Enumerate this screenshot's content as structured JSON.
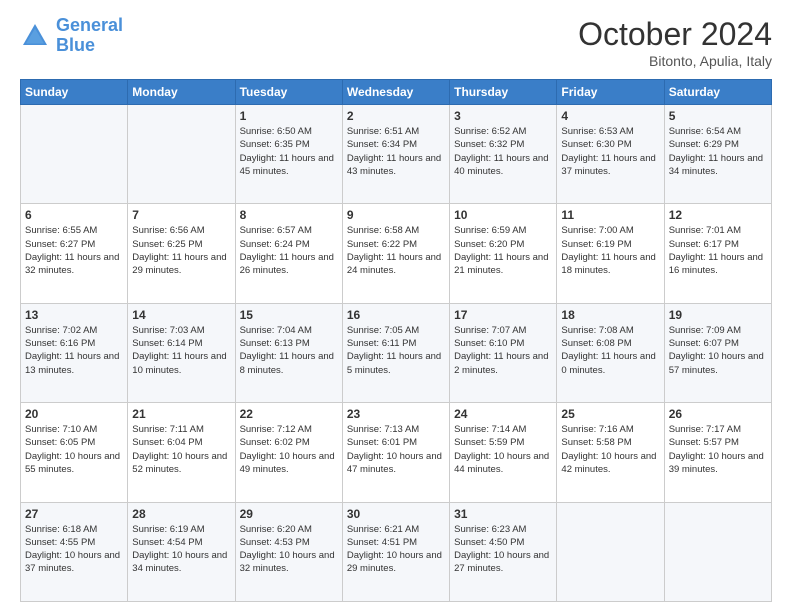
{
  "header": {
    "logo_line1": "General",
    "logo_line2": "Blue",
    "month_title": "October 2024",
    "subtitle": "Bitonto, Apulia, Italy"
  },
  "days_of_week": [
    "Sunday",
    "Monday",
    "Tuesday",
    "Wednesday",
    "Thursday",
    "Friday",
    "Saturday"
  ],
  "weeks": [
    [
      {
        "day": "",
        "info": ""
      },
      {
        "day": "",
        "info": ""
      },
      {
        "day": "1",
        "sunrise": "6:50 AM",
        "sunset": "6:35 PM",
        "daylight": "11 hours and 45 minutes."
      },
      {
        "day": "2",
        "sunrise": "6:51 AM",
        "sunset": "6:34 PM",
        "daylight": "11 hours and 43 minutes."
      },
      {
        "day": "3",
        "sunrise": "6:52 AM",
        "sunset": "6:32 PM",
        "daylight": "11 hours and 40 minutes."
      },
      {
        "day": "4",
        "sunrise": "6:53 AM",
        "sunset": "6:30 PM",
        "daylight": "11 hours and 37 minutes."
      },
      {
        "day": "5",
        "sunrise": "6:54 AM",
        "sunset": "6:29 PM",
        "daylight": "11 hours and 34 minutes."
      }
    ],
    [
      {
        "day": "6",
        "sunrise": "6:55 AM",
        "sunset": "6:27 PM",
        "daylight": "11 hours and 32 minutes."
      },
      {
        "day": "7",
        "sunrise": "6:56 AM",
        "sunset": "6:25 PM",
        "daylight": "11 hours and 29 minutes."
      },
      {
        "day": "8",
        "sunrise": "6:57 AM",
        "sunset": "6:24 PM",
        "daylight": "11 hours and 26 minutes."
      },
      {
        "day": "9",
        "sunrise": "6:58 AM",
        "sunset": "6:22 PM",
        "daylight": "11 hours and 24 minutes."
      },
      {
        "day": "10",
        "sunrise": "6:59 AM",
        "sunset": "6:20 PM",
        "daylight": "11 hours and 21 minutes."
      },
      {
        "day": "11",
        "sunrise": "7:00 AM",
        "sunset": "6:19 PM",
        "daylight": "11 hours and 18 minutes."
      },
      {
        "day": "12",
        "sunrise": "7:01 AM",
        "sunset": "6:17 PM",
        "daylight": "11 hours and 16 minutes."
      }
    ],
    [
      {
        "day": "13",
        "sunrise": "7:02 AM",
        "sunset": "6:16 PM",
        "daylight": "11 hours and 13 minutes."
      },
      {
        "day": "14",
        "sunrise": "7:03 AM",
        "sunset": "6:14 PM",
        "daylight": "11 hours and 10 minutes."
      },
      {
        "day": "15",
        "sunrise": "7:04 AM",
        "sunset": "6:13 PM",
        "daylight": "11 hours and 8 minutes."
      },
      {
        "day": "16",
        "sunrise": "7:05 AM",
        "sunset": "6:11 PM",
        "daylight": "11 hours and 5 minutes."
      },
      {
        "day": "17",
        "sunrise": "7:07 AM",
        "sunset": "6:10 PM",
        "daylight": "11 hours and 2 minutes."
      },
      {
        "day": "18",
        "sunrise": "7:08 AM",
        "sunset": "6:08 PM",
        "daylight": "11 hours and 0 minutes."
      },
      {
        "day": "19",
        "sunrise": "7:09 AM",
        "sunset": "6:07 PM",
        "daylight": "10 hours and 57 minutes."
      }
    ],
    [
      {
        "day": "20",
        "sunrise": "7:10 AM",
        "sunset": "6:05 PM",
        "daylight": "10 hours and 55 minutes."
      },
      {
        "day": "21",
        "sunrise": "7:11 AM",
        "sunset": "6:04 PM",
        "daylight": "10 hours and 52 minutes."
      },
      {
        "day": "22",
        "sunrise": "7:12 AM",
        "sunset": "6:02 PM",
        "daylight": "10 hours and 49 minutes."
      },
      {
        "day": "23",
        "sunrise": "7:13 AM",
        "sunset": "6:01 PM",
        "daylight": "10 hours and 47 minutes."
      },
      {
        "day": "24",
        "sunrise": "7:14 AM",
        "sunset": "5:59 PM",
        "daylight": "10 hours and 44 minutes."
      },
      {
        "day": "25",
        "sunrise": "7:16 AM",
        "sunset": "5:58 PM",
        "daylight": "10 hours and 42 minutes."
      },
      {
        "day": "26",
        "sunrise": "7:17 AM",
        "sunset": "5:57 PM",
        "daylight": "10 hours and 39 minutes."
      }
    ],
    [
      {
        "day": "27",
        "sunrise": "6:18 AM",
        "sunset": "4:55 PM",
        "daylight": "10 hours and 37 minutes."
      },
      {
        "day": "28",
        "sunrise": "6:19 AM",
        "sunset": "4:54 PM",
        "daylight": "10 hours and 34 minutes."
      },
      {
        "day": "29",
        "sunrise": "6:20 AM",
        "sunset": "4:53 PM",
        "daylight": "10 hours and 32 minutes."
      },
      {
        "day": "30",
        "sunrise": "6:21 AM",
        "sunset": "4:51 PM",
        "daylight": "10 hours and 29 minutes."
      },
      {
        "day": "31",
        "sunrise": "6:23 AM",
        "sunset": "4:50 PM",
        "daylight": "10 hours and 27 minutes."
      },
      {
        "day": "",
        "info": ""
      },
      {
        "day": "",
        "info": ""
      }
    ]
  ]
}
